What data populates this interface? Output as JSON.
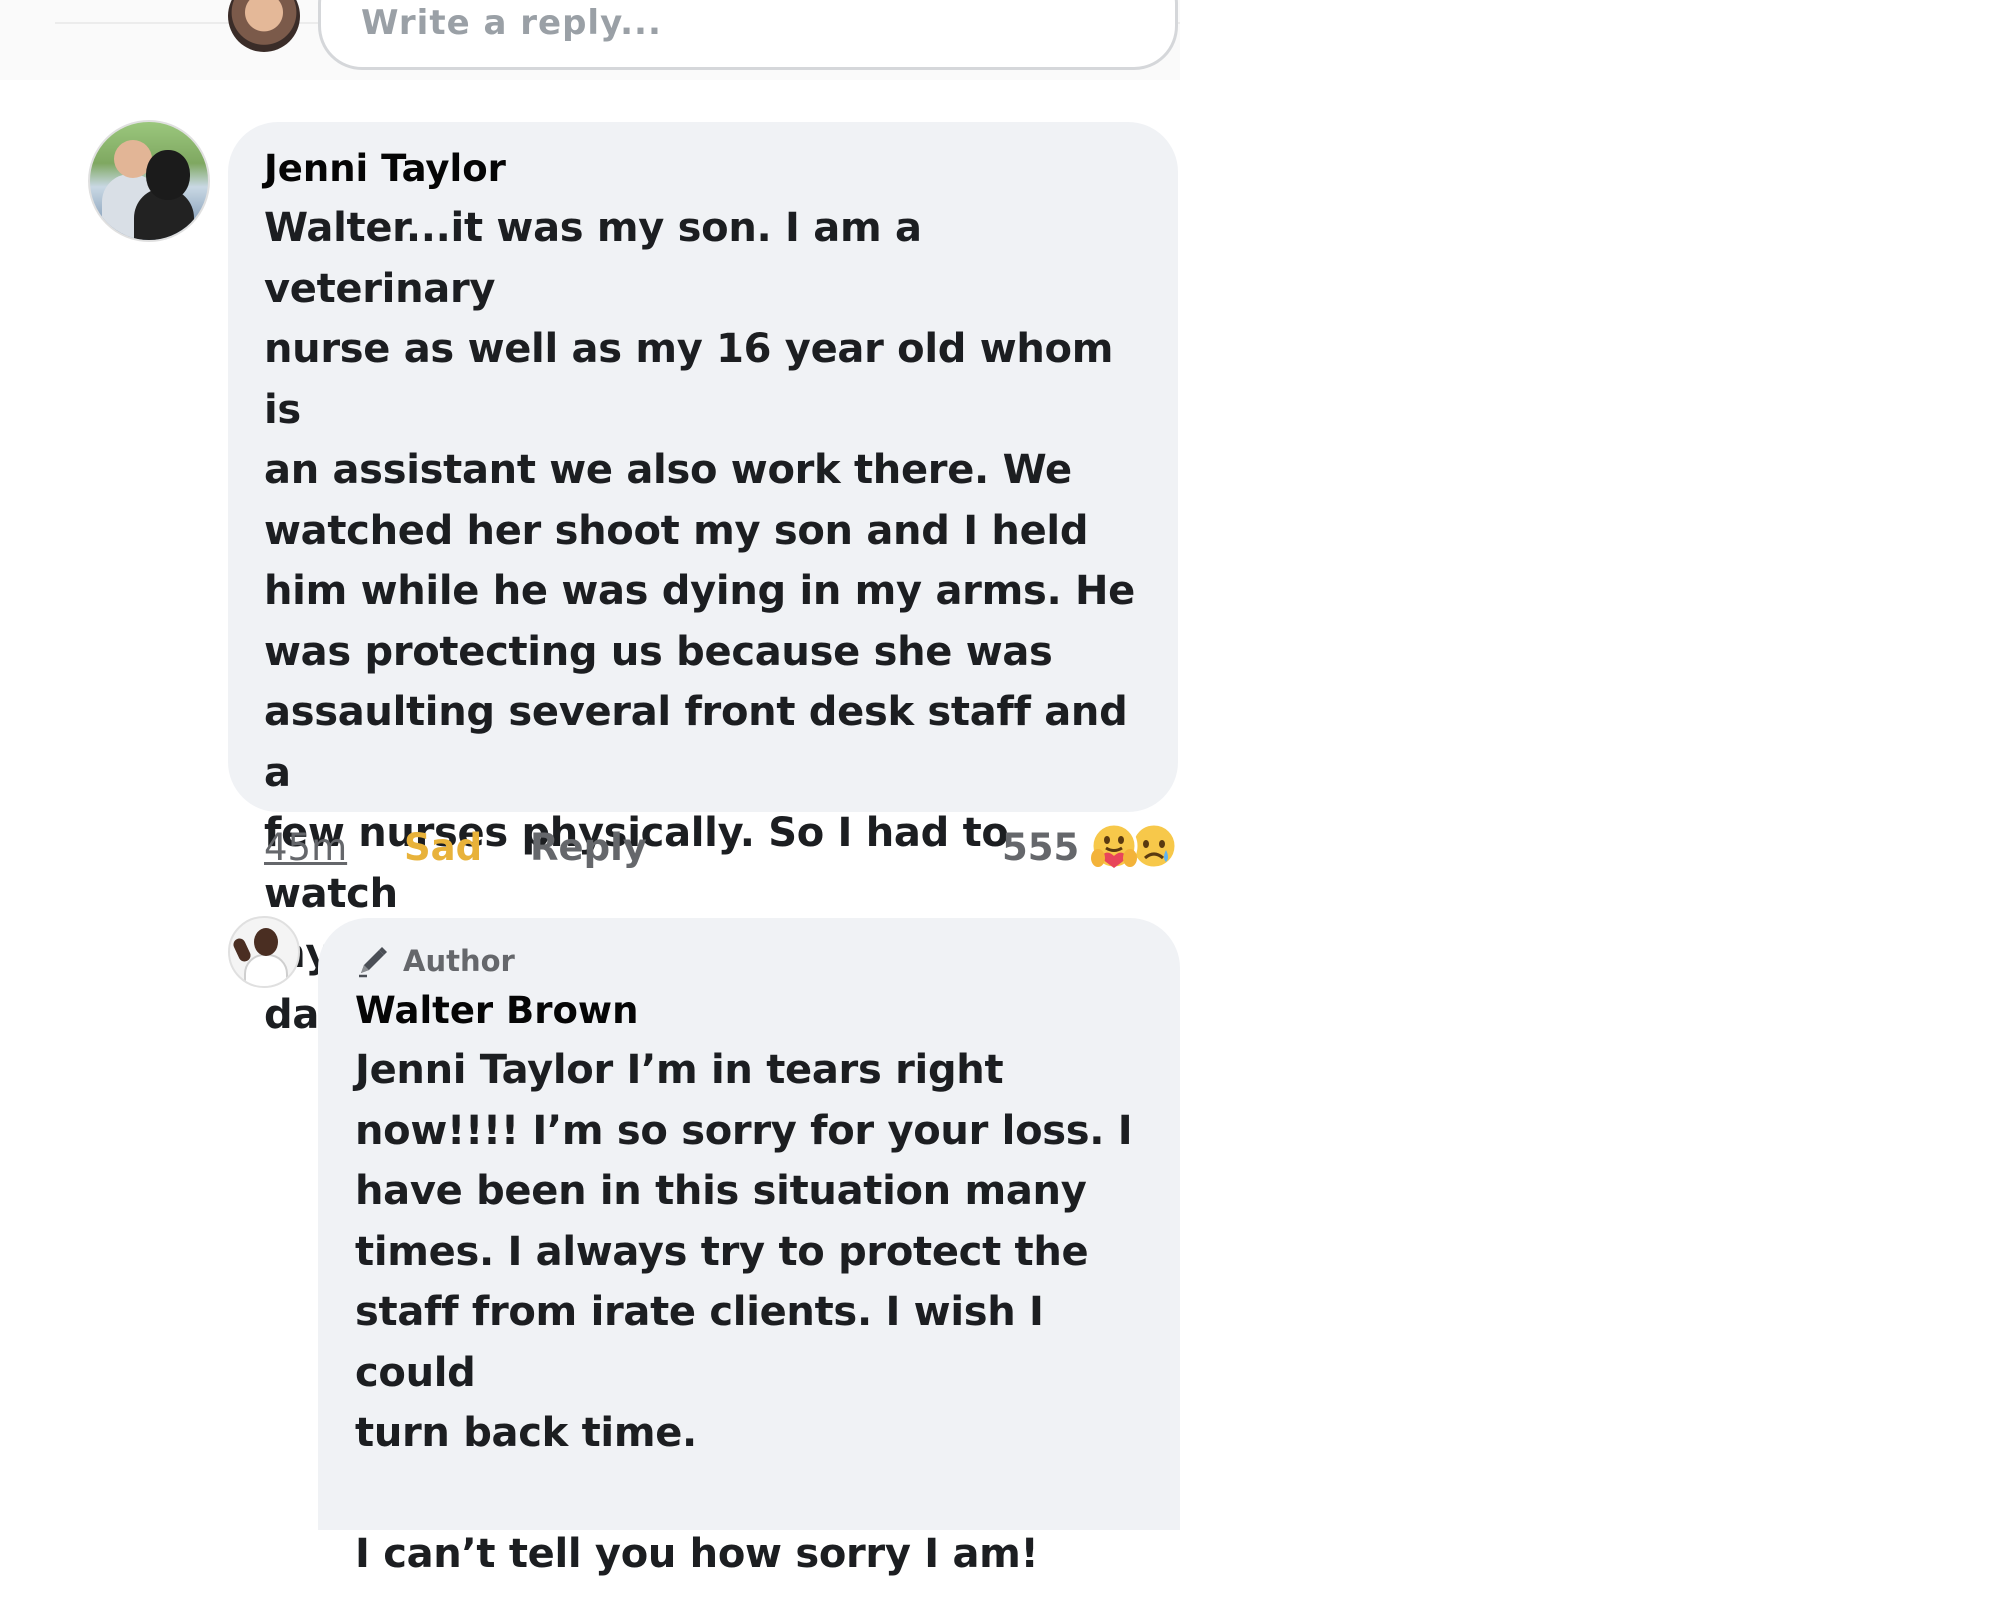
{
  "reply_box": {
    "placeholder": "Write a reply..."
  },
  "comments": [
    {
      "author": "Jenni Taylor",
      "text": "Walter...it was my son. I am a veterinary\nnurse as well as my 16 year old whom is\nan assistant we  also work there. We\nwatched her shoot my son and I held\nhim while he was dying in my arms. He\nwas protecting us because she was\nassaulting several front desk staff and a\nfew nurses physically. So I had to watch\nmy child dying in my arms on mother's\ndays.",
      "time": "45m",
      "reaction_label": "Sad",
      "reply_label": "Reply",
      "reaction_count": "555",
      "reaction_icons": [
        "care-reaction-icon",
        "sad-reaction-icon"
      ]
    },
    {
      "badge": "Author",
      "author": "Walter Brown",
      "text": "Jenni Taylor I’m in tears right\nnow!!!! I’m so sorry for your loss. I\nhave been in this situation many\ntimes. I always try to protect the\nstaff from irate clients. I wish I could\nturn back time.\n\nI can’t tell you how sorry I am!"
    }
  ],
  "colors": {
    "bubble": "#f0f2f5",
    "sad_reaction": "#e8b23a",
    "muted_text": "#65676b"
  }
}
